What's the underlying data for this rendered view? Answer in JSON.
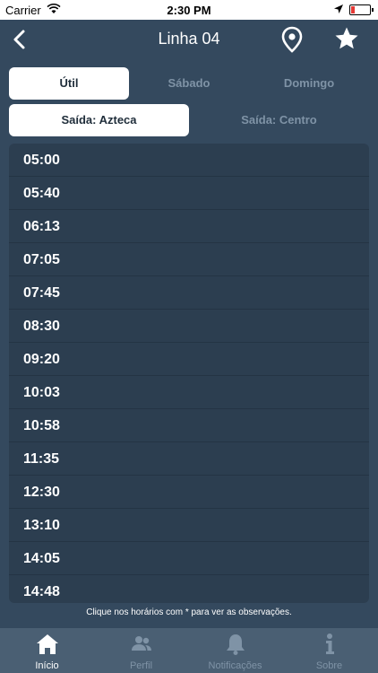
{
  "status": {
    "carrier": "Carrier",
    "time": "2:30 PM"
  },
  "nav": {
    "title": "Linha 04"
  },
  "days": {
    "options": [
      "Útil",
      "Sábado",
      "Domingo"
    ],
    "selected": "Útil"
  },
  "directions": {
    "options": [
      "Saída: Azteca",
      "Saída: Centro"
    ],
    "selected": "Saída: Azteca"
  },
  "schedule": [
    "05:00",
    "05:40",
    "06:13",
    "07:05",
    "07:45",
    "08:30",
    "09:20",
    "10:03",
    "10:58",
    "11:35",
    "12:30",
    "13:10",
    "14:05",
    "14:48"
  ],
  "note": "Clique nos horários com * para ver as observações.",
  "tabs": [
    {
      "label": "Início",
      "icon": "home-icon",
      "active": true
    },
    {
      "label": "Perfil",
      "icon": "profile-icon",
      "active": false
    },
    {
      "label": "Notificações",
      "icon": "bell-icon",
      "active": false
    },
    {
      "label": "Sobre",
      "icon": "info-icon",
      "active": false
    }
  ],
  "colors": {
    "background": "#34495e",
    "list": "#2c3e50",
    "tabbar": "#4a5f73",
    "inactive": "#7f93a6"
  }
}
